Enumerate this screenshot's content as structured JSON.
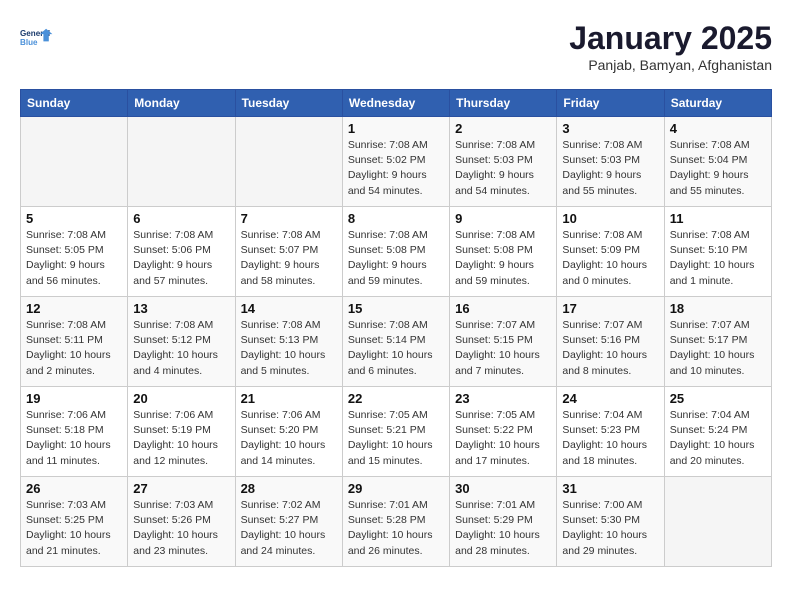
{
  "header": {
    "logo_line1": "General",
    "logo_line2": "Blue",
    "title": "January 2025",
    "subtitle": "Panjab, Bamyan, Afghanistan"
  },
  "weekdays": [
    "Sunday",
    "Monday",
    "Tuesday",
    "Wednesday",
    "Thursday",
    "Friday",
    "Saturday"
  ],
  "weeks": [
    [
      {
        "day": "",
        "info": ""
      },
      {
        "day": "",
        "info": ""
      },
      {
        "day": "",
        "info": ""
      },
      {
        "day": "1",
        "info": "Sunrise: 7:08 AM\nSunset: 5:02 PM\nDaylight: 9 hours\nand 54 minutes."
      },
      {
        "day": "2",
        "info": "Sunrise: 7:08 AM\nSunset: 5:03 PM\nDaylight: 9 hours\nand 54 minutes."
      },
      {
        "day": "3",
        "info": "Sunrise: 7:08 AM\nSunset: 5:03 PM\nDaylight: 9 hours\nand 55 minutes."
      },
      {
        "day": "4",
        "info": "Sunrise: 7:08 AM\nSunset: 5:04 PM\nDaylight: 9 hours\nand 55 minutes."
      }
    ],
    [
      {
        "day": "5",
        "info": "Sunrise: 7:08 AM\nSunset: 5:05 PM\nDaylight: 9 hours\nand 56 minutes."
      },
      {
        "day": "6",
        "info": "Sunrise: 7:08 AM\nSunset: 5:06 PM\nDaylight: 9 hours\nand 57 minutes."
      },
      {
        "day": "7",
        "info": "Sunrise: 7:08 AM\nSunset: 5:07 PM\nDaylight: 9 hours\nand 58 minutes."
      },
      {
        "day": "8",
        "info": "Sunrise: 7:08 AM\nSunset: 5:08 PM\nDaylight: 9 hours\nand 59 minutes."
      },
      {
        "day": "9",
        "info": "Sunrise: 7:08 AM\nSunset: 5:08 PM\nDaylight: 9 hours\nand 59 minutes."
      },
      {
        "day": "10",
        "info": "Sunrise: 7:08 AM\nSunset: 5:09 PM\nDaylight: 10 hours\nand 0 minutes."
      },
      {
        "day": "11",
        "info": "Sunrise: 7:08 AM\nSunset: 5:10 PM\nDaylight: 10 hours\nand 1 minute."
      }
    ],
    [
      {
        "day": "12",
        "info": "Sunrise: 7:08 AM\nSunset: 5:11 PM\nDaylight: 10 hours\nand 2 minutes."
      },
      {
        "day": "13",
        "info": "Sunrise: 7:08 AM\nSunset: 5:12 PM\nDaylight: 10 hours\nand 4 minutes."
      },
      {
        "day": "14",
        "info": "Sunrise: 7:08 AM\nSunset: 5:13 PM\nDaylight: 10 hours\nand 5 minutes."
      },
      {
        "day": "15",
        "info": "Sunrise: 7:08 AM\nSunset: 5:14 PM\nDaylight: 10 hours\nand 6 minutes."
      },
      {
        "day": "16",
        "info": "Sunrise: 7:07 AM\nSunset: 5:15 PM\nDaylight: 10 hours\nand 7 minutes."
      },
      {
        "day": "17",
        "info": "Sunrise: 7:07 AM\nSunset: 5:16 PM\nDaylight: 10 hours\nand 8 minutes."
      },
      {
        "day": "18",
        "info": "Sunrise: 7:07 AM\nSunset: 5:17 PM\nDaylight: 10 hours\nand 10 minutes."
      }
    ],
    [
      {
        "day": "19",
        "info": "Sunrise: 7:06 AM\nSunset: 5:18 PM\nDaylight: 10 hours\nand 11 minutes."
      },
      {
        "day": "20",
        "info": "Sunrise: 7:06 AM\nSunset: 5:19 PM\nDaylight: 10 hours\nand 12 minutes."
      },
      {
        "day": "21",
        "info": "Sunrise: 7:06 AM\nSunset: 5:20 PM\nDaylight: 10 hours\nand 14 minutes."
      },
      {
        "day": "22",
        "info": "Sunrise: 7:05 AM\nSunset: 5:21 PM\nDaylight: 10 hours\nand 15 minutes."
      },
      {
        "day": "23",
        "info": "Sunrise: 7:05 AM\nSunset: 5:22 PM\nDaylight: 10 hours\nand 17 minutes."
      },
      {
        "day": "24",
        "info": "Sunrise: 7:04 AM\nSunset: 5:23 PM\nDaylight: 10 hours\nand 18 minutes."
      },
      {
        "day": "25",
        "info": "Sunrise: 7:04 AM\nSunset: 5:24 PM\nDaylight: 10 hours\nand 20 minutes."
      }
    ],
    [
      {
        "day": "26",
        "info": "Sunrise: 7:03 AM\nSunset: 5:25 PM\nDaylight: 10 hours\nand 21 minutes."
      },
      {
        "day": "27",
        "info": "Sunrise: 7:03 AM\nSunset: 5:26 PM\nDaylight: 10 hours\nand 23 minutes."
      },
      {
        "day": "28",
        "info": "Sunrise: 7:02 AM\nSunset: 5:27 PM\nDaylight: 10 hours\nand 24 minutes."
      },
      {
        "day": "29",
        "info": "Sunrise: 7:01 AM\nSunset: 5:28 PM\nDaylight: 10 hours\nand 26 minutes."
      },
      {
        "day": "30",
        "info": "Sunrise: 7:01 AM\nSunset: 5:29 PM\nDaylight: 10 hours\nand 28 minutes."
      },
      {
        "day": "31",
        "info": "Sunrise: 7:00 AM\nSunset: 5:30 PM\nDaylight: 10 hours\nand 29 minutes."
      },
      {
        "day": "",
        "info": ""
      }
    ]
  ]
}
